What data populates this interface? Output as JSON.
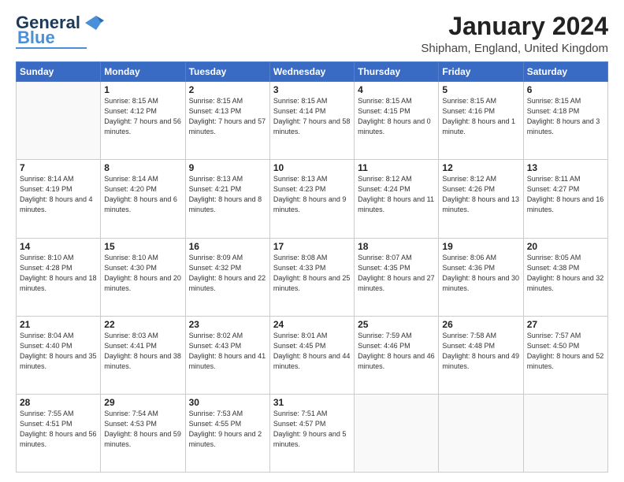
{
  "header": {
    "logo_general": "General",
    "logo_blue": "Blue",
    "main_title": "January 2024",
    "subtitle": "Shipham, England, United Kingdom"
  },
  "calendar": {
    "days_of_week": [
      "Sunday",
      "Monday",
      "Tuesday",
      "Wednesday",
      "Thursday",
      "Friday",
      "Saturday"
    ],
    "weeks": [
      [
        {
          "day": "",
          "info": ""
        },
        {
          "day": "1",
          "info": "Sunrise: 8:15 AM\nSunset: 4:12 PM\nDaylight: 7 hours\nand 56 minutes."
        },
        {
          "day": "2",
          "info": "Sunrise: 8:15 AM\nSunset: 4:13 PM\nDaylight: 7 hours\nand 57 minutes."
        },
        {
          "day": "3",
          "info": "Sunrise: 8:15 AM\nSunset: 4:14 PM\nDaylight: 7 hours\nand 58 minutes."
        },
        {
          "day": "4",
          "info": "Sunrise: 8:15 AM\nSunset: 4:15 PM\nDaylight: 8 hours\nand 0 minutes."
        },
        {
          "day": "5",
          "info": "Sunrise: 8:15 AM\nSunset: 4:16 PM\nDaylight: 8 hours\nand 1 minute."
        },
        {
          "day": "6",
          "info": "Sunrise: 8:15 AM\nSunset: 4:18 PM\nDaylight: 8 hours\nand 3 minutes."
        }
      ],
      [
        {
          "day": "7",
          "info": "Sunrise: 8:14 AM\nSunset: 4:19 PM\nDaylight: 8 hours\nand 4 minutes."
        },
        {
          "day": "8",
          "info": "Sunrise: 8:14 AM\nSunset: 4:20 PM\nDaylight: 8 hours\nand 6 minutes."
        },
        {
          "day": "9",
          "info": "Sunrise: 8:13 AM\nSunset: 4:21 PM\nDaylight: 8 hours\nand 8 minutes."
        },
        {
          "day": "10",
          "info": "Sunrise: 8:13 AM\nSunset: 4:23 PM\nDaylight: 8 hours\nand 9 minutes."
        },
        {
          "day": "11",
          "info": "Sunrise: 8:12 AM\nSunset: 4:24 PM\nDaylight: 8 hours\nand 11 minutes."
        },
        {
          "day": "12",
          "info": "Sunrise: 8:12 AM\nSunset: 4:26 PM\nDaylight: 8 hours\nand 13 minutes."
        },
        {
          "day": "13",
          "info": "Sunrise: 8:11 AM\nSunset: 4:27 PM\nDaylight: 8 hours\nand 16 minutes."
        }
      ],
      [
        {
          "day": "14",
          "info": "Sunrise: 8:10 AM\nSunset: 4:28 PM\nDaylight: 8 hours\nand 18 minutes."
        },
        {
          "day": "15",
          "info": "Sunrise: 8:10 AM\nSunset: 4:30 PM\nDaylight: 8 hours\nand 20 minutes."
        },
        {
          "day": "16",
          "info": "Sunrise: 8:09 AM\nSunset: 4:32 PM\nDaylight: 8 hours\nand 22 minutes."
        },
        {
          "day": "17",
          "info": "Sunrise: 8:08 AM\nSunset: 4:33 PM\nDaylight: 8 hours\nand 25 minutes."
        },
        {
          "day": "18",
          "info": "Sunrise: 8:07 AM\nSunset: 4:35 PM\nDaylight: 8 hours\nand 27 minutes."
        },
        {
          "day": "19",
          "info": "Sunrise: 8:06 AM\nSunset: 4:36 PM\nDaylight: 8 hours\nand 30 minutes."
        },
        {
          "day": "20",
          "info": "Sunrise: 8:05 AM\nSunset: 4:38 PM\nDaylight: 8 hours\nand 32 minutes."
        }
      ],
      [
        {
          "day": "21",
          "info": "Sunrise: 8:04 AM\nSunset: 4:40 PM\nDaylight: 8 hours\nand 35 minutes."
        },
        {
          "day": "22",
          "info": "Sunrise: 8:03 AM\nSunset: 4:41 PM\nDaylight: 8 hours\nand 38 minutes."
        },
        {
          "day": "23",
          "info": "Sunrise: 8:02 AM\nSunset: 4:43 PM\nDaylight: 8 hours\nand 41 minutes."
        },
        {
          "day": "24",
          "info": "Sunrise: 8:01 AM\nSunset: 4:45 PM\nDaylight: 8 hours\nand 44 minutes."
        },
        {
          "day": "25",
          "info": "Sunrise: 7:59 AM\nSunset: 4:46 PM\nDaylight: 8 hours\nand 46 minutes."
        },
        {
          "day": "26",
          "info": "Sunrise: 7:58 AM\nSunset: 4:48 PM\nDaylight: 8 hours\nand 49 minutes."
        },
        {
          "day": "27",
          "info": "Sunrise: 7:57 AM\nSunset: 4:50 PM\nDaylight: 8 hours\nand 52 minutes."
        }
      ],
      [
        {
          "day": "28",
          "info": "Sunrise: 7:55 AM\nSunset: 4:51 PM\nDaylight: 8 hours\nand 56 minutes."
        },
        {
          "day": "29",
          "info": "Sunrise: 7:54 AM\nSunset: 4:53 PM\nDaylight: 8 hours\nand 59 minutes."
        },
        {
          "day": "30",
          "info": "Sunrise: 7:53 AM\nSunset: 4:55 PM\nDaylight: 9 hours\nand 2 minutes."
        },
        {
          "day": "31",
          "info": "Sunrise: 7:51 AM\nSunset: 4:57 PM\nDaylight: 9 hours\nand 5 minutes."
        },
        {
          "day": "",
          "info": ""
        },
        {
          "day": "",
          "info": ""
        },
        {
          "day": "",
          "info": ""
        }
      ]
    ]
  }
}
